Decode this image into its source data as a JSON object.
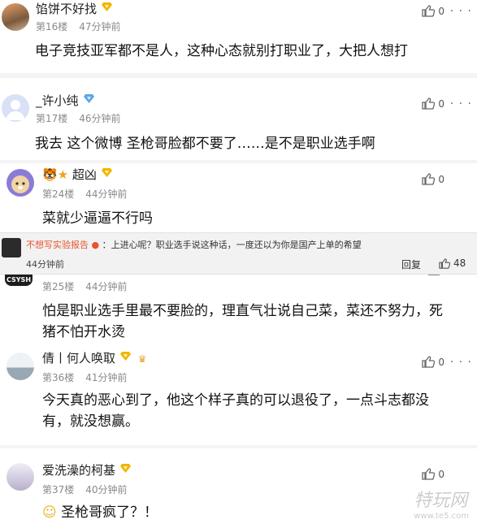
{
  "comments": [
    {
      "user": "馅饼不好找",
      "floor": "第16楼",
      "time": "47分钟前",
      "text": "电子竞技亚军都不是人，这种心态就别打职业了，大把人想打",
      "likes": "0"
    },
    {
      "user": "_许小纯",
      "floor": "第17楼",
      "time": "46分钟前",
      "text": "我去 这个微博 圣枪哥脸都不要了……是不是职业选手啊",
      "likes": "0"
    },
    {
      "user": "超凶",
      "floor": "第24楼",
      "time": "44分钟前",
      "text": "菜就少逼逼不行吗",
      "likes": "0"
    },
    {
      "floor": "第25楼",
      "time": "44分钟前",
      "text_line1": "怕是职业选手里最不要脸的，理直气壮说自己菜，菜还不努力，死",
      "text_line2": "猪不怕开水烫"
    },
    {
      "user": "倩丨何人唤取",
      "floor": "第36楼",
      "time": "41分钟前",
      "text_line1": "今天真的恶心到了，他这个样子真的可以退役了，一点斗志都没",
      "text_line2": "有，就没想赢。",
      "likes": "0"
    },
    {
      "user": "爱洗澡的柯基",
      "floor": "第37楼",
      "time": "40分钟前",
      "text": "圣枪哥疯了？！",
      "likes": "0"
    }
  ],
  "repost": {
    "user": "不想写实验报告",
    "text": "：上进心呢？职业选手说这种话，一度还以为你是国产上单的希望",
    "time": "44分钟前",
    "reply_label": "回复",
    "likes": "48",
    "avatar_text": "CSYSH"
  },
  "watermark": {
    "main": "特玩网",
    "sub": "www.te5.com"
  },
  "colors": {
    "repost_name": "#e8542e",
    "meta": "#8a8a8a",
    "badge": "#f4b400",
    "vip_blue": "#5aa7e6"
  }
}
